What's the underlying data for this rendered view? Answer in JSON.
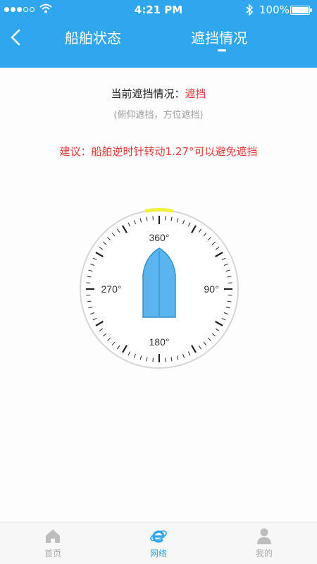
{
  "status_bar": {
    "time": "4:21 PM",
    "battery": "100%"
  },
  "nav": {
    "tab_ship_status": "船舶状态",
    "tab_blocking": "遮挡情况"
  },
  "content": {
    "current_label": "当前遮挡情况：",
    "current_value": "遮挡",
    "detail": "(俯仰遮挡，方位遮挡)",
    "suggestion": "建议：船舶逆时针转动1.27°可以避免遮挡"
  },
  "compass": {
    "north": "360°",
    "east": "90°",
    "south": "180°",
    "west": "270°",
    "highlight_color": "#f1ef3f",
    "ship_color": "#5ab4ee"
  },
  "tabbar": {
    "home": "首页",
    "network": "网络",
    "mine": "我的"
  },
  "colors": {
    "accent": "#2fa6ee",
    "warning": "#e53935"
  }
}
